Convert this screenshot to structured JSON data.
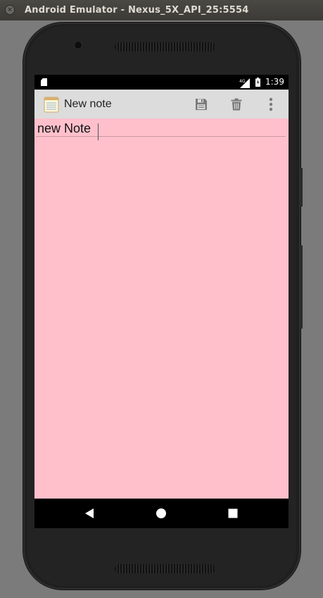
{
  "window": {
    "title": "Android Emulator - Nexus_5X_API_25:5554"
  },
  "status_bar": {
    "network": "4G",
    "time": "1:39"
  },
  "app_bar": {
    "title": "New note",
    "actions": [
      "save-icon",
      "trash-icon",
      "overflow-menu-icon"
    ]
  },
  "note": {
    "text": "new Note"
  },
  "colors": {
    "note_background": "#ffc0cb",
    "app_bar": "#dcdcdc"
  },
  "nav_bar": [
    "back-icon",
    "home-icon",
    "recents-icon"
  ]
}
